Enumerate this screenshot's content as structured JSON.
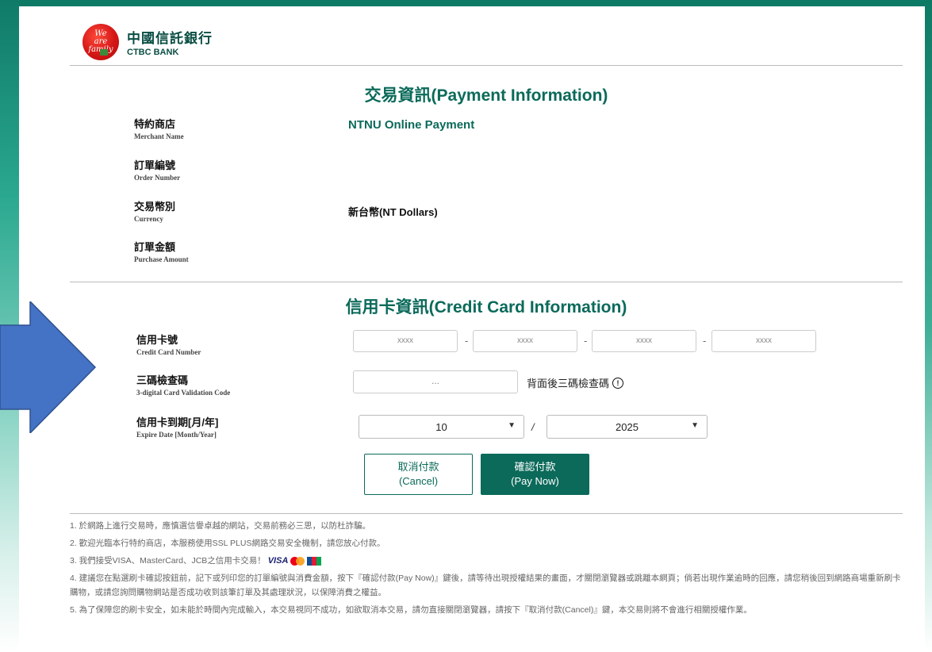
{
  "brand": {
    "logo_script": "We are family",
    "name_cn": "中國信託銀行",
    "name_en": "CTBC BANK"
  },
  "payment_info": {
    "title": "交易資訊(Payment Information)",
    "merchant": {
      "label_cn": "特約商店",
      "label_en": "Merchant Name",
      "value": "NTNU Online Payment"
    },
    "order": {
      "label_cn": "訂單編號",
      "label_en": "Order Number",
      "value": ""
    },
    "currency": {
      "label_cn": "交易幣別",
      "label_en": "Currency",
      "value": "新台幣(NT Dollars)"
    },
    "amount": {
      "label_cn": "訂單金額",
      "label_en": "Purchase Amount",
      "value": ""
    }
  },
  "card_info": {
    "title": "信用卡資訊(Credit Card Information)",
    "card_number": {
      "label_cn": "信用卡號",
      "label_en": "Credit Card Number",
      "segments": [
        "xxxx",
        "xxxx",
        "xxxx",
        "xxxx"
      ],
      "separator": "-"
    },
    "cvv": {
      "label_cn": "三碼檢查碼",
      "label_en": "3-digital Card Validation Code",
      "placeholder": "...",
      "hint": "背面後三碼檢查碼",
      "info_icon_glyph": "!"
    },
    "expiry": {
      "label_cn": "信用卡到期[月/年]",
      "label_en": "Expire Date [Month/Year]",
      "month": "10",
      "year": "2025",
      "separator": "/"
    }
  },
  "buttons": {
    "cancel_cn": "取消付款",
    "cancel_en": "(Cancel)",
    "pay_cn": "確認付款",
    "pay_en": "(Pay Now)"
  },
  "notes": [
    "1. 於網路上進行交易時，應慎選信譽卓越的網站，交易前務必三思，以防杜詐騙。",
    "2. 歡迎光臨本行特約商店，本服務使用SSL PLUS網路交易安全機制，請您放心付款。",
    "3. 我們接受VISA、MasterCard、JCB之信用卡交易！",
    "4. 建議您在點選刷卡確認按鈕前，記下或列印您的訂單編號與消費金額，按下『確認付款(Pay Now)』鍵後，請等待出現授權結果的畫面，才關閉瀏覽器或跳離本網頁；倘若出現作業逾時的回應，請您稍後回到網路商場重新刷卡購物，或請您詢問購物網站是否成功收到該筆訂單及其處理狀況，以保障消費之權益。",
    "5. 為了保障您的刷卡安全，如未能於時間內完成輸入，本交易視同不成功，如欲取消本交易，請勿直接關閉瀏覽器，請按下『取消付款(Cancel)』鍵，本交易則將不會進行相關授權作業。"
  ],
  "card_logos": {
    "visa": "VISA"
  },
  "colors": {
    "brand_green": "#0b6a5a",
    "arrow_blue": "#4472c4",
    "logo_red": "#d41616"
  }
}
